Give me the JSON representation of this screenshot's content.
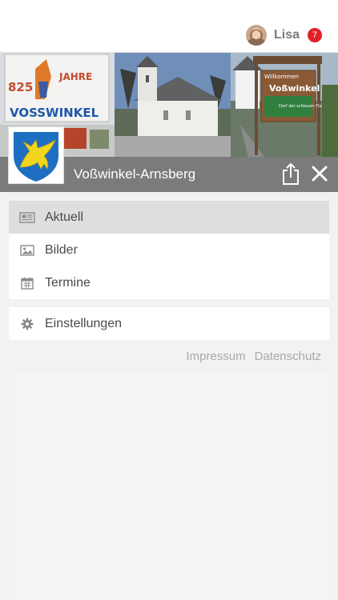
{
  "user": {
    "name": "Lisa",
    "notification_count": "7"
  },
  "site": {
    "title": "Voßwinkel-Arnsberg"
  },
  "hero": {
    "sign_jubilee_number": "825",
    "sign_jubilee_word": "JAHRE",
    "sign_left_name": "VOSSWINKEL",
    "sign_right_welcome": "Willkommen",
    "sign_right_name": "Voßwinkel",
    "sign_right_slogan": "Dorf der schlauen Füchse!"
  },
  "menu_primary": [
    {
      "label": "Aktuell",
      "icon": "newspaper-icon",
      "active": true
    },
    {
      "label": "Bilder",
      "icon": "image-icon",
      "active": false
    },
    {
      "label": "Termine",
      "icon": "calendar-icon",
      "active": false
    }
  ],
  "menu_secondary": [
    {
      "label": "Einstellungen",
      "icon": "gear-icon"
    }
  ],
  "footer_links": {
    "impressum": "Impressum",
    "datenschutz": "Datenschutz"
  },
  "colors": {
    "accent_badge": "#e21f26",
    "title_bar": "#7b7b7b",
    "active_item": "#dedede"
  }
}
